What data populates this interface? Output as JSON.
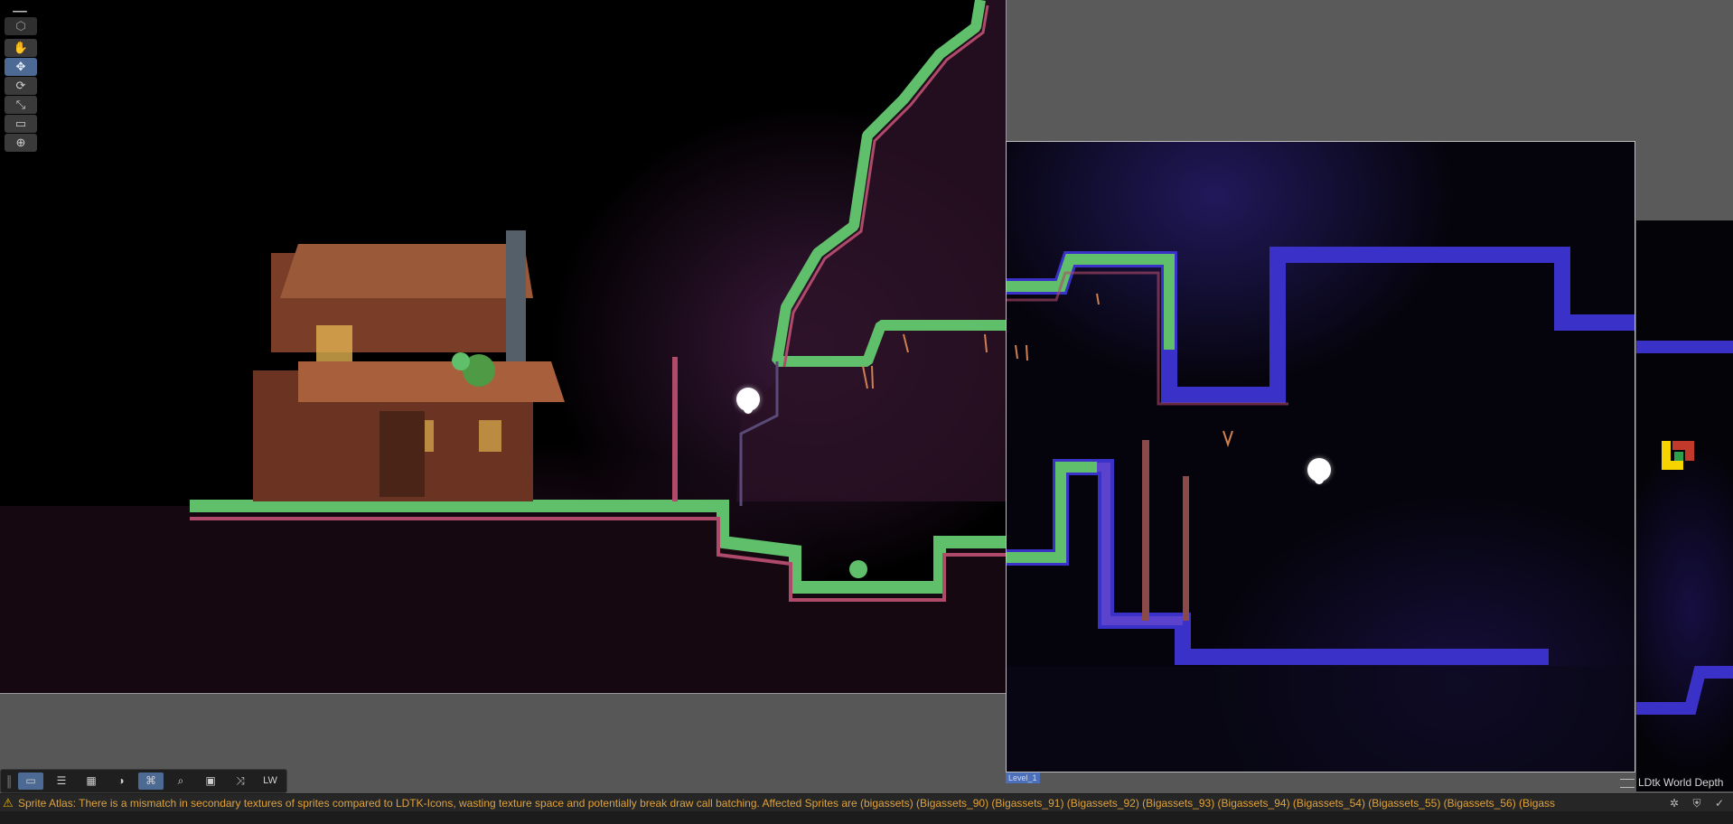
{
  "scene_toolbar": {
    "tools": [
      {
        "name": "hand-tool",
        "icon": "✋",
        "active": false
      },
      {
        "name": "move-tool",
        "icon": "✥",
        "active": true
      },
      {
        "name": "rotate-tool",
        "icon": "⟳",
        "active": false
      },
      {
        "name": "scale-tool",
        "icon": "⤡",
        "active": false
      },
      {
        "name": "rect-tool",
        "icon": "▭",
        "active": false
      },
      {
        "name": "transform-tool",
        "icon": "⊕",
        "active": false
      }
    ]
  },
  "overlay_toolbar": {
    "lw_label": "LW"
  },
  "level": {
    "name": "Level_1"
  },
  "world_depth": {
    "label": "LDtk World Depth"
  },
  "status": {
    "message": "Sprite Atlas: There is a mismatch in secondary textures of sprites compared to LDTK-Icons, wasting texture space and potentially break draw call batching. Affected Sprites are (bigassets) (Bigassets_90) (Bigassets_91) (Bigassets_92) (Bigassets_93) (Bigassets_94) (Bigassets_54) (Bigassets_55) (Bigassets_56) (Bigass"
  },
  "colors": {
    "active_button": "#4c6a93",
    "warning_text": "#e0a23a",
    "grass_green": "#5fbf6a",
    "cave_pink": "#b04a6a",
    "cave_blue": "#3a32c8",
    "house_brown": "#9a5a3a"
  }
}
